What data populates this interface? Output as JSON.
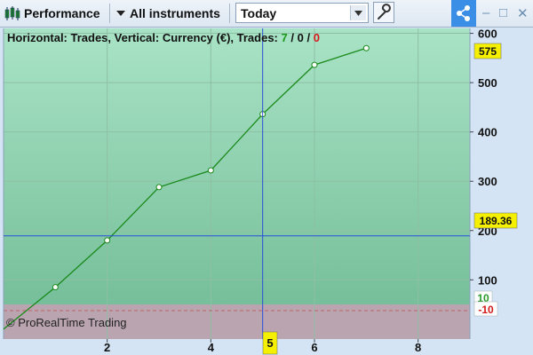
{
  "toolbar": {
    "title": "Performance",
    "instruments_label": "All instruments",
    "period_value": "Today",
    "icons": [
      "candlestick-icon",
      "dropdown-arrow-icon",
      "wrench-icon",
      "share-icon",
      "minimize-icon",
      "maximize-icon",
      "close-icon"
    ]
  },
  "window": {
    "minimize": "–",
    "maximize": "□",
    "close": "✕"
  },
  "chart_header": {
    "text": "Horizontal: Trades, Vertical: Currency (€), Trades:",
    "wins": "7",
    "slash1": "/",
    "neutral": "0",
    "slash2": "/",
    "losses": "0"
  },
  "watermark": "© ProRealTime Trading",
  "price_labels": {
    "last": "575",
    "cursor_y": "189.36",
    "cursor_x": "5",
    "low_green": "10",
    "low_red": "-10"
  },
  "colors": {
    "line": "#1a8a1a",
    "area_top": "#a9e3c6",
    "area_bottom": "#76bf9a",
    "loss_zone": "#b9a4b0",
    "crosshair": "#2b4fd8",
    "label_bg": "#f5f000"
  },
  "chart_data": {
    "type": "line",
    "x": [
      0,
      1,
      2,
      3,
      4,
      5,
      6,
      7
    ],
    "y": [
      0,
      85,
      180,
      288,
      322,
      436,
      536,
      570
    ],
    "xlim": [
      0,
      9
    ],
    "ylim": [
      -20,
      610
    ],
    "x_ticks": [
      "2",
      "4",
      "6",
      "8"
    ],
    "y_ticks": [
      "100",
      "200",
      "300",
      "400",
      "500",
      "600"
    ],
    "crosshair": {
      "x": 5,
      "y": 189.36
    },
    "grid": true
  }
}
